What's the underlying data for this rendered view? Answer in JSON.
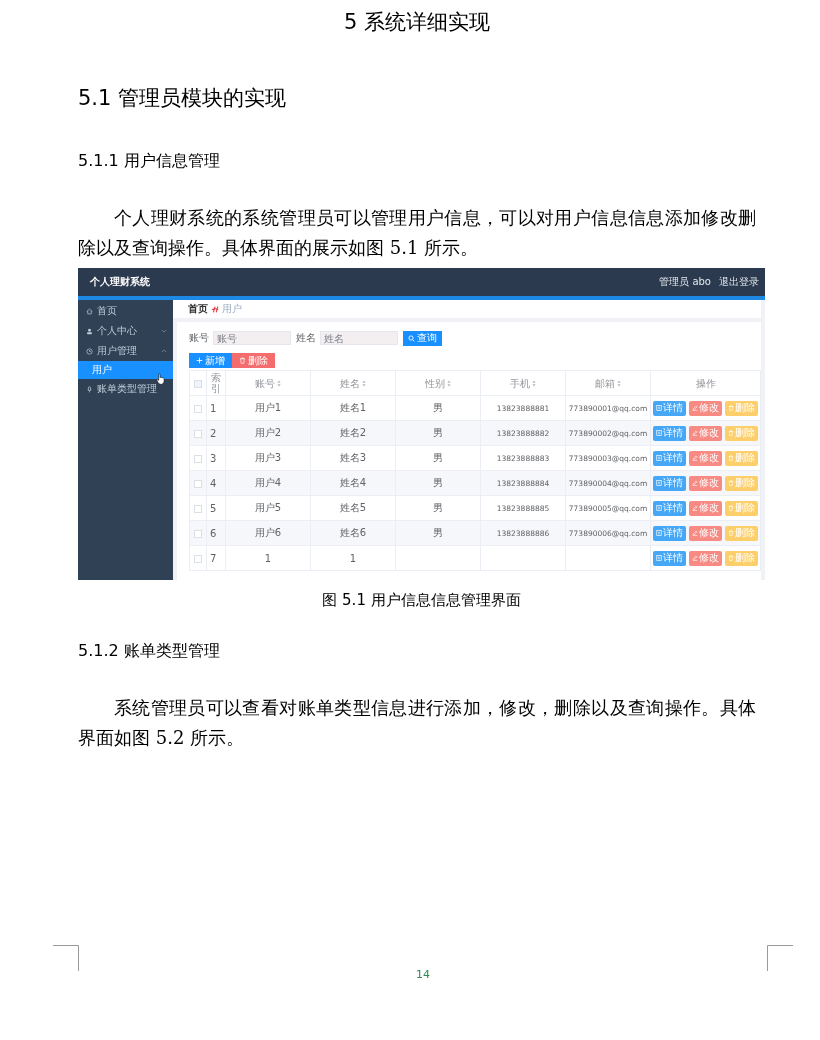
{
  "chapter_title": "5 系统详细实现",
  "section_title": "5.1 管理员模块的实现",
  "subsection_1": {
    "title": "5.1.1 用户信息管理",
    "paragraph": "个人理财系统的系统管理员可以管理用户信息，可以对用户信息信息添加修改删除以及查询操作。具体界面的展示如图 5.1 所示。"
  },
  "figure": {
    "app_title": "个人理财系统",
    "user_label": "管理员 abo",
    "logout": "退出登录",
    "sidebar": {
      "items": [
        {
          "label": "首页",
          "kind": "link",
          "selected": false
        },
        {
          "label": "个人中心",
          "kind": "group",
          "expanded": false,
          "selected": false
        },
        {
          "label": "用户管理",
          "kind": "group",
          "expanded": true,
          "selected": false,
          "children": [
            {
              "label": "用户",
              "selected": true
            }
          ]
        },
        {
          "label": "账单类型管理",
          "kind": "link",
          "selected": false
        }
      ]
    },
    "breadcrumb": [
      "首页",
      "用户"
    ],
    "search": {
      "fields": [
        {
          "label": "账号",
          "placeholder": "账号"
        },
        {
          "label": "姓名",
          "placeholder": "姓名"
        }
      ],
      "button": "查询"
    },
    "toolbar": [
      {
        "label": "新增",
        "kind": "add"
      },
      {
        "label": "删除",
        "kind": "delete"
      }
    ],
    "table": {
      "all_checked": false,
      "columns": [
        {
          "label": "索引",
          "sortable": false
        },
        {
          "label": "账号",
          "sortable": true
        },
        {
          "label": "姓名",
          "sortable": true
        },
        {
          "label": "性别",
          "sortable": true
        },
        {
          "label": "手机",
          "sortable": true
        },
        {
          "label": "邮箱",
          "sortable": true
        },
        {
          "label": "操作",
          "sortable": false
        }
      ],
      "rows": [
        {
          "checked": false,
          "cells": [
            "1",
            "用户1",
            "姓名1",
            "男",
            "13823888881",
            "773890001@qq.com"
          ],
          "actions": [
            {
              "label": "详情",
              "kind": "detail"
            },
            {
              "label": "修改",
              "kind": "edit"
            },
            {
              "label": "删除",
              "kind": "delete"
            }
          ]
        },
        {
          "checked": false,
          "cells": [
            "2",
            "用户2",
            "姓名2",
            "男",
            "13823888882",
            "773890002@qq.com"
          ],
          "actions": [
            {
              "label": "详情",
              "kind": "detail"
            },
            {
              "label": "修改",
              "kind": "edit"
            },
            {
              "label": "删除",
              "kind": "delete"
            }
          ]
        },
        {
          "checked": false,
          "cells": [
            "3",
            "用户3",
            "姓名3",
            "男",
            "13823888883",
            "773890003@qq.com"
          ],
          "actions": [
            {
              "label": "详情",
              "kind": "detail"
            },
            {
              "label": "修改",
              "kind": "edit"
            },
            {
              "label": "删除",
              "kind": "delete"
            }
          ]
        },
        {
          "checked": false,
          "cells": [
            "4",
            "用户4",
            "姓名4",
            "男",
            "13823888884",
            "773890004@qq.com"
          ],
          "actions": [
            {
              "label": "详情",
              "kind": "detail"
            },
            {
              "label": "修改",
              "kind": "edit"
            },
            {
              "label": "删除",
              "kind": "delete"
            }
          ]
        },
        {
          "checked": false,
          "cells": [
            "5",
            "用户5",
            "姓名5",
            "男",
            "13823888885",
            "773890005@qq.com"
          ],
          "actions": [
            {
              "label": "详情",
              "kind": "detail"
            },
            {
              "label": "修改",
              "kind": "edit"
            },
            {
              "label": "删除",
              "kind": "delete"
            }
          ]
        },
        {
          "checked": false,
          "cells": [
            "6",
            "用户6",
            "姓名6",
            "男",
            "13823888886",
            "773890006@qq.com"
          ],
          "actions": [
            {
              "label": "详情",
              "kind": "detail"
            },
            {
              "label": "修改",
              "kind": "edit"
            },
            {
              "label": "删除",
              "kind": "delete"
            }
          ]
        },
        {
          "checked": false,
          "cells": [
            "7",
            "1",
            "1",
            "",
            "",
            ""
          ],
          "actions": [
            {
              "label": "详情",
              "kind": "detail"
            },
            {
              "label": "修改",
              "kind": "edit"
            },
            {
              "label": "删除",
              "kind": "delete"
            }
          ]
        }
      ]
    }
  },
  "caption": "图 5.1 用户信息信息管理界面",
  "subsection_2": {
    "title": "5.1.2 账单类型管理",
    "paragraph": "系统管理员可以查看对账单类型信息进行添加，修改，删除以及查询操作。具体界面如图 5.2 所示。"
  },
  "page_number": "14"
}
